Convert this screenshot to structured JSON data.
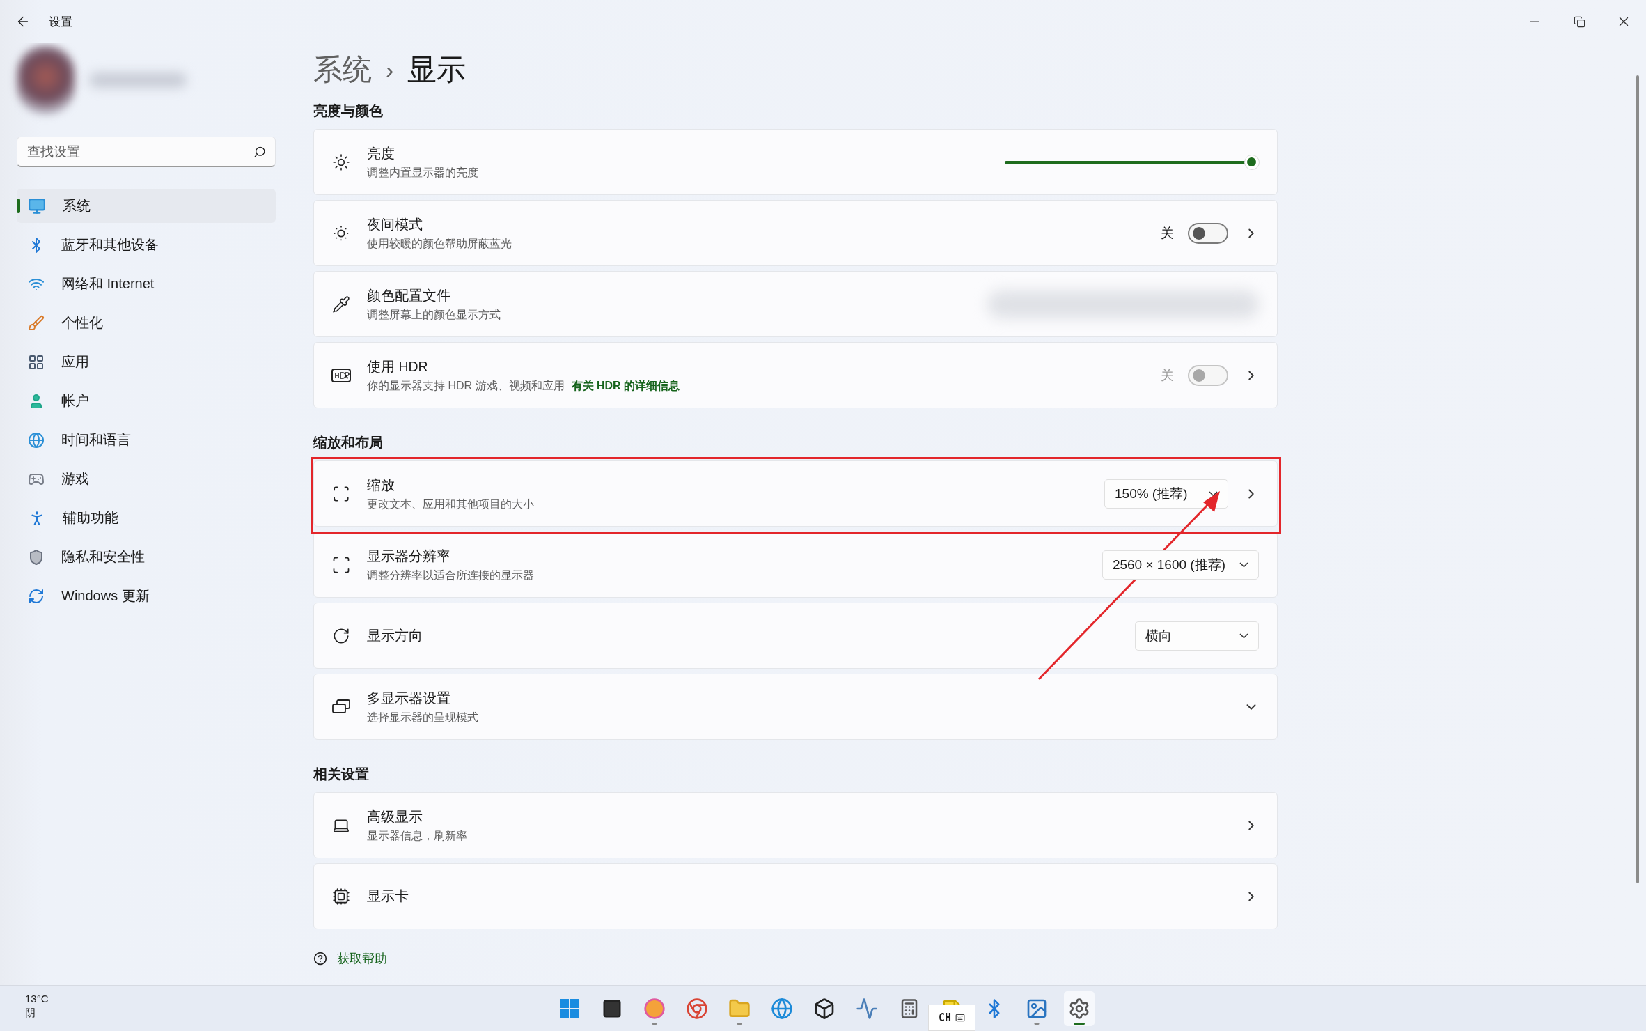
{
  "window": {
    "title": "设置"
  },
  "sidebar": {
    "search": {
      "placeholder": "查找设置"
    },
    "items": [
      {
        "label": "系统",
        "selected": true
      },
      {
        "label": "蓝牙和其他设备",
        "selected": false
      },
      {
        "label": "网络和 Internet",
        "selected": false
      },
      {
        "label": "个性化",
        "selected": false
      },
      {
        "label": "应用",
        "selected": false
      },
      {
        "label": "帐户",
        "selected": false
      },
      {
        "label": "时间和语言",
        "selected": false
      },
      {
        "label": "游戏",
        "selected": false
      },
      {
        "label": "辅助功能",
        "selected": false
      },
      {
        "label": "隐私和安全性",
        "selected": false
      },
      {
        "label": "Windows 更新",
        "selected": false
      }
    ]
  },
  "breadcrumb": {
    "parent": "系统",
    "separator": "›",
    "current": "显示"
  },
  "sections": [
    {
      "title": "亮度与颜色",
      "rows": [
        {
          "kind": "slider",
          "title": "亮度",
          "subtitle": "调整内置显示器的亮度",
          "level": 1
        },
        {
          "kind": "toggle",
          "title": "夜间模式",
          "subtitle": "使用较暖的颜色帮助屏蔽蓝光",
          "state_label": "关",
          "on": false,
          "disabled": false
        },
        {
          "kind": "hidden",
          "title": "颜色配置文件",
          "subtitle": "调整屏幕上的颜色显示方式"
        },
        {
          "kind": "toggle",
          "title": "使用 HDR",
          "subtitle": "你的显示器支持 HDR 游戏、视频和应用",
          "link": "有关 HDR 的详细信息",
          "state_label": "关",
          "on": false,
          "disabled": true
        }
      ]
    },
    {
      "title": "缩放和布局",
      "rows": [
        {
          "kind": "dropdown",
          "title": "缩放",
          "subtitle": "更改文本、应用和其他项目的大小",
          "value": "150% (推荐)",
          "chevron": true,
          "annotated": true
        },
        {
          "kind": "dropdown",
          "title": "显示器分辨率",
          "subtitle": "调整分辨率以适合所连接的显示器",
          "value": "2560 × 1600 (推荐)",
          "chevron": false,
          "annotated": false
        },
        {
          "kind": "dropdown",
          "title": "显示方向",
          "value": "横向",
          "chevron": false,
          "annotated": false
        },
        {
          "kind": "expander",
          "title": "多显示器设置",
          "subtitle": "选择显示器的呈现模式",
          "expanded": false
        }
      ]
    },
    {
      "title": "相关设置",
      "rows": [
        {
          "kind": "nav",
          "title": "高级显示",
          "subtitle": "显示器信息，刷新率"
        },
        {
          "kind": "nav",
          "title": "显示卡"
        }
      ]
    }
  ],
  "help": {
    "label": "获取帮助"
  },
  "taskbar": {
    "weather": {
      "temperature": "13°C",
      "condition": "阴"
    },
    "apps": [
      {
        "running": false,
        "active": false
      },
      {
        "running": false,
        "active": false
      },
      {
        "running": true,
        "active": false
      },
      {
        "running": false,
        "active": false
      },
      {
        "running": true,
        "active": false
      },
      {
        "running": false,
        "active": false
      },
      {
        "running": false,
        "active": false
      },
      {
        "running": false,
        "active": false
      },
      {
        "running": false,
        "active": false
      },
      {
        "running": false,
        "active": false
      },
      {
        "running": false,
        "active": false
      },
      {
        "running": true,
        "active": false
      },
      {
        "running": true,
        "active": true
      }
    ],
    "ime": {
      "label": "CH"
    }
  }
}
